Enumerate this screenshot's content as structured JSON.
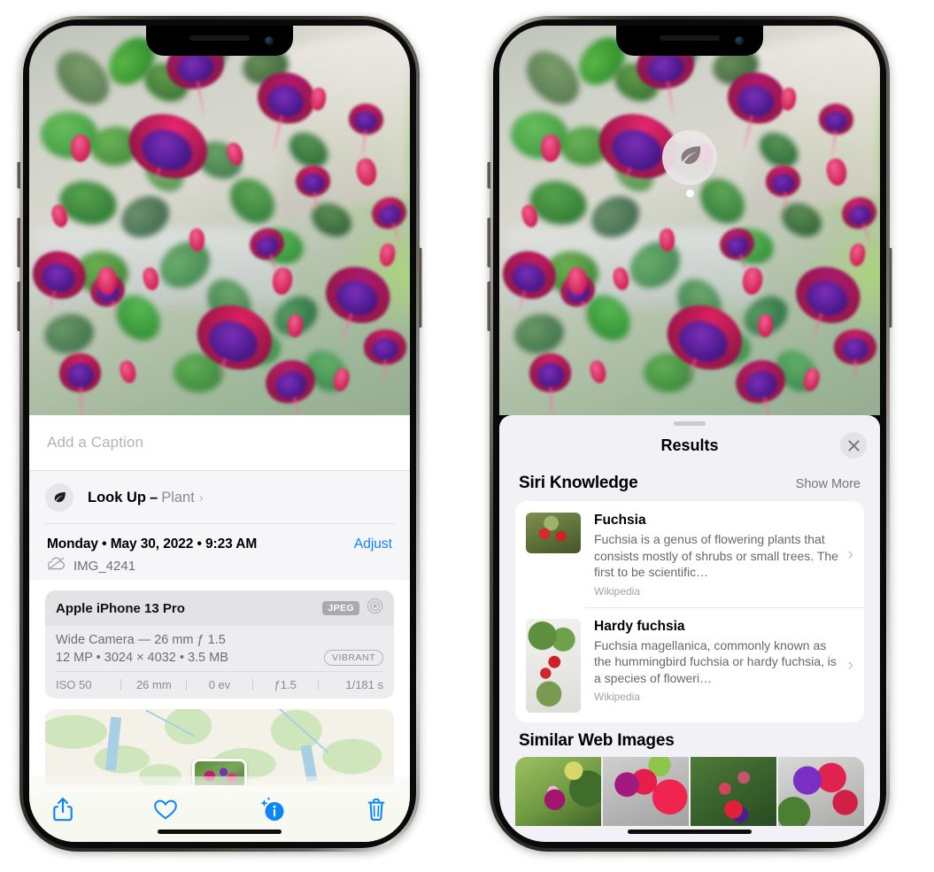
{
  "left_phone": {
    "caption": {
      "placeholder": "Add a Caption",
      "value": ""
    },
    "lookup": {
      "icon": "leaf-icon",
      "label": "Look Up",
      "dash": "–",
      "subject": "Plant",
      "chevron": "›"
    },
    "meta": {
      "date": "Monday • May 30, 2022 • 9:23 AM",
      "adjust_label": "Adjust",
      "cloud_icon": "icloud-slash-icon",
      "filename": "IMG_4241"
    },
    "camera_card": {
      "device": "Apple iPhone 13 Pro",
      "format_badge": "JPEG",
      "lens_icon": "aperture-icon",
      "lens_line": "Wide Camera — 26 mm ƒ 1.5",
      "spec_line": "12 MP • 3024 × 4032 • 3.5 MB",
      "style_badge": "VIBRANT",
      "exif": [
        "ISO 50",
        "26 mm",
        "0 ev",
        "ƒ1.5",
        "1/181 s"
      ]
    },
    "toolbar": [
      {
        "name": "share-icon",
        "label": "Share"
      },
      {
        "name": "heart-icon",
        "label": "Favorite"
      },
      {
        "name": "info-sparkle-icon",
        "label": "Info"
      },
      {
        "name": "trash-icon",
        "label": "Delete"
      }
    ]
  },
  "right_phone": {
    "visual_lookup_badge": {
      "icon": "leaf-icon",
      "label": "Plant detected"
    },
    "sheet": {
      "title": "Results",
      "close_icon": "close-icon"
    },
    "siri_knowledge": {
      "title": "Siri Knowledge",
      "show_more": "Show More",
      "items": [
        {
          "title": "Fuchsia",
          "description": "Fuchsia is a genus of flowering plants that consists mostly of shrubs or small trees. The first to be scientific…",
          "source": "Wikipedia",
          "chevron": "›"
        },
        {
          "title": "Hardy fuchsia",
          "description": "Fuchsia magellanica, commonly known as the hummingbird fuchsia or hardy fuchsia, is a species of floweri…",
          "source": "Wikipedia",
          "chevron": "›"
        }
      ]
    },
    "similar_web_images": {
      "title": "Similar Web Images",
      "count": 4
    }
  },
  "colors": {
    "accent_blue": "#0a84ff",
    "sheet_bg": "#f2f1f6",
    "card_bg": "#ffffff",
    "secondary_text": "#68686d",
    "toolbar_bg": "#f7f9f1"
  }
}
